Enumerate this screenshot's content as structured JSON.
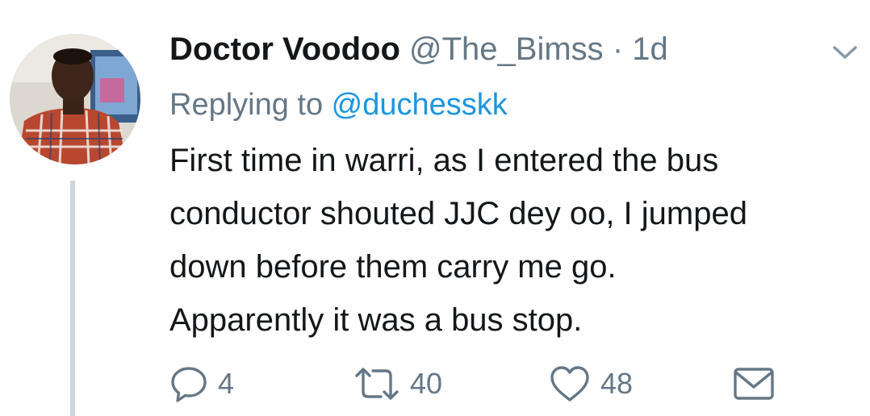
{
  "tweet": {
    "author": {
      "display_name": "Doctor Voodoo",
      "handle": "@The_Bimss",
      "separator": "·",
      "time": "1d"
    },
    "reply": {
      "prefix": "Replying to ",
      "handle": "@duchesskk"
    },
    "text_lines": [
      "First time in warri, as I entered the bus",
      "conductor shouted JJC dey oo, I jumped",
      "down before them carry me go.",
      "Apparently it was a bus stop."
    ],
    "actions": {
      "reply_count": "4",
      "retweet_count": "40",
      "like_count": "48"
    },
    "icons": {
      "reply": "reply-icon",
      "retweet": "retweet-icon",
      "like": "heart-icon",
      "dm": "envelope-icon",
      "menu": "chevron-down-icon"
    },
    "colors": {
      "name": "#14171a",
      "secondary": "#657786",
      "link": "#1b95e0",
      "thread_line": "#ccd6dd"
    }
  }
}
